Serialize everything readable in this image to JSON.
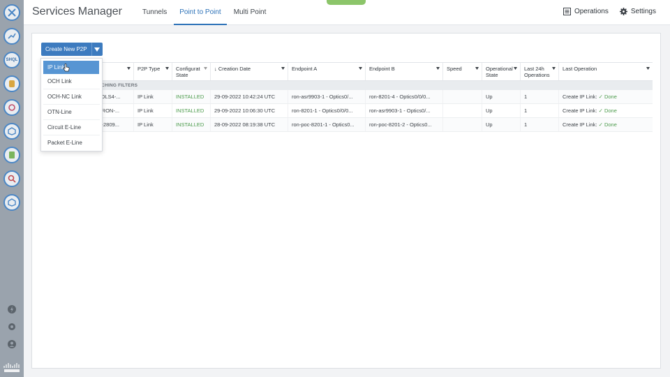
{
  "app": {
    "title": "Services Manager"
  },
  "tabs": [
    {
      "label": "Tunnels"
    },
    {
      "label": "Point to Point"
    },
    {
      "label": "Multi Point"
    }
  ],
  "header_actions": [
    {
      "label": "Operations",
      "icon": "list-icon"
    },
    {
      "label": "Settings",
      "icon": "gear-icon"
    }
  ],
  "create_button": {
    "label": "Create New P2P"
  },
  "dropdown": {
    "items": [
      "IP Link",
      "OCH Link",
      "OCH-NC Link",
      "OTN-Line",
      "Circuit E-Line",
      "Packet E-Line"
    ],
    "selected": "IP Link"
  },
  "table": {
    "columns": [
      {
        "label": ""
      },
      {
        "label": "P2P Type"
      },
      {
        "label": "Configurat State"
      },
      {
        "label": "↓ Creation Date"
      },
      {
        "label": "Endpoint A"
      },
      {
        "label": "Endpoint B"
      },
      {
        "label": "Speed"
      },
      {
        "label": "Operational State"
      },
      {
        "label": "Last 24h Operations"
      },
      {
        "label": "Last Operation"
      }
    ],
    "filter_label": "TCHING FILTERS",
    "rows": [
      {
        "name": "S3-OLS4-...",
        "type": "IP Link",
        "config": "INSTALLED",
        "date": "29-09-2022 10:42:24 UTC",
        "ep_a": "ron-asr9903-1 - Optics0/...",
        "ep_b": "ron-8201-4 - Optics0/0/0...",
        "speed": "",
        "op_state": "Up",
        "ops": "1",
        "last_op": "Create IP Link:",
        "last_op_status": "✓ Done"
      },
      {
        "name": "4-RON-...",
        "type": "IP Link",
        "config": "INSTALLED",
        "date": "29-09-2022 10:06:30 UTC",
        "ep_a": "ron-8201-1 - Optics0/0/0...",
        "ep_b": "ron-asr9903-1 - Optics0/...",
        "speed": "",
        "op_state": "Up",
        "ops": "1",
        "last_op": "Create IP Link:",
        "last_op_status": "✓ Done"
      },
      {
        "name": "202-2809...",
        "type": "IP Link",
        "config": "INSTALLED",
        "date": "28-09-2022 08:19:38 UTC",
        "ep_a": "ron-poc-8201-1 - Optics0...",
        "ep_b": "ron-poc-8201-2 - Optics0...",
        "speed": "",
        "op_state": "Up",
        "ops": "1",
        "last_op": "Create IP Link:",
        "last_op_status": "✓ Done"
      }
    ]
  },
  "rail": {
    "sql_label": "SHQL"
  },
  "colors": {
    "accent": "#2d72b8",
    "button": "#3d7bbf",
    "success": "#4a9a4a",
    "rail": "#9aa3ad"
  }
}
